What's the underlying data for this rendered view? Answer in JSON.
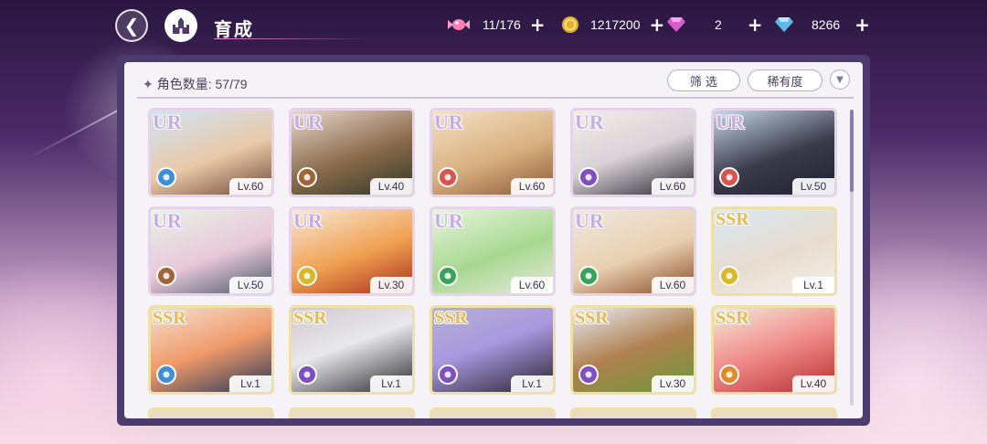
{
  "header": {
    "title": "育成",
    "resources": [
      {
        "icon": "candy-icon",
        "value": "11/176"
      },
      {
        "icon": "gold-coin-icon",
        "value": "1217200"
      },
      {
        "icon": "pink-diamond-icon",
        "value": "2"
      },
      {
        "icon": "blue-diamond-icon",
        "value": "8266"
      }
    ]
  },
  "panel": {
    "count_label": "角色数量: 57/79",
    "filter_label": "筛 选",
    "sort_label": "稀有度"
  },
  "colors": {
    "blue": "#3f8fd6",
    "brown": "#a0633a",
    "red": "#d9534f",
    "purple": "#7d4fc1",
    "yellow": "#d9b82a",
    "green": "#3aa35a",
    "orange": "#e08a2a"
  },
  "cards": [
    {
      "rarity": "UR",
      "level": "Lv.60",
      "attr": "blue"
    },
    {
      "rarity": "UR",
      "level": "Lv.40",
      "attr": "brown"
    },
    {
      "rarity": "UR",
      "level": "Lv.60",
      "attr": "red"
    },
    {
      "rarity": "UR",
      "level": "Lv.60",
      "attr": "purple"
    },
    {
      "rarity": "UR",
      "level": "Lv.50",
      "attr": "red"
    },
    {
      "rarity": "UR",
      "level": "Lv.50",
      "attr": "brown"
    },
    {
      "rarity": "UR",
      "level": "Lv.30",
      "attr": "yellow"
    },
    {
      "rarity": "UR",
      "level": "Lv.60",
      "attr": "green"
    },
    {
      "rarity": "UR",
      "level": "Lv.60",
      "attr": "green"
    },
    {
      "rarity": "SSR",
      "level": "Lv.1",
      "attr": "yellow"
    },
    {
      "rarity": "SSR",
      "level": "Lv.1",
      "attr": "blue"
    },
    {
      "rarity": "SSR",
      "level": "Lv.1",
      "attr": "purple"
    },
    {
      "rarity": "SSR",
      "level": "Lv.1",
      "attr": "purple"
    },
    {
      "rarity": "SSR",
      "level": "Lv.30",
      "attr": "purple"
    },
    {
      "rarity": "SSR",
      "level": "Lv.40",
      "attr": "orange"
    }
  ]
}
